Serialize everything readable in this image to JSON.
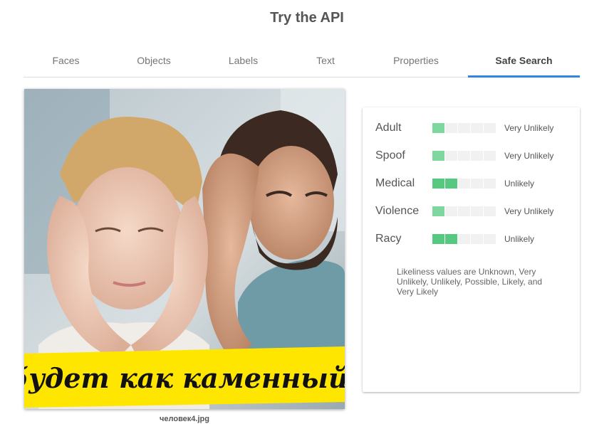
{
  "page": {
    "title": "Try the API"
  },
  "tabs": [
    {
      "label": "Faces",
      "active": false
    },
    {
      "label": "Objects",
      "active": false
    },
    {
      "label": "Labels",
      "active": false
    },
    {
      "label": "Text",
      "active": false
    },
    {
      "label": "Properties",
      "active": false
    },
    {
      "label": "Safe Search",
      "active": true
    }
  ],
  "image": {
    "caption": "человек4.jpg",
    "overlay_text": "будет как каменный!"
  },
  "safe_search": {
    "rows": [
      {
        "label": "Adult",
        "value": "Very Unlikely",
        "level": 1,
        "max_level": 5
      },
      {
        "label": "Spoof",
        "value": "Very Unlikely",
        "level": 1,
        "max_level": 5
      },
      {
        "label": "Medical",
        "value": "Unlikely",
        "level": 2,
        "max_level": 5
      },
      {
        "label": "Violence",
        "value": "Very Unlikely",
        "level": 1,
        "max_level": 5
      },
      {
        "label": "Racy",
        "value": "Unlikely",
        "level": 2,
        "max_level": 5
      }
    ],
    "footnote": "Likeliness values are Unknown, Very Unlikely, Unlikely, Possible, Likely, and Very Likely"
  },
  "colors": {
    "accent": "#2e86de",
    "meter_on": "#56c980",
    "meter_off": "#f1f1f1",
    "banner_yellow": "#ffe600"
  }
}
